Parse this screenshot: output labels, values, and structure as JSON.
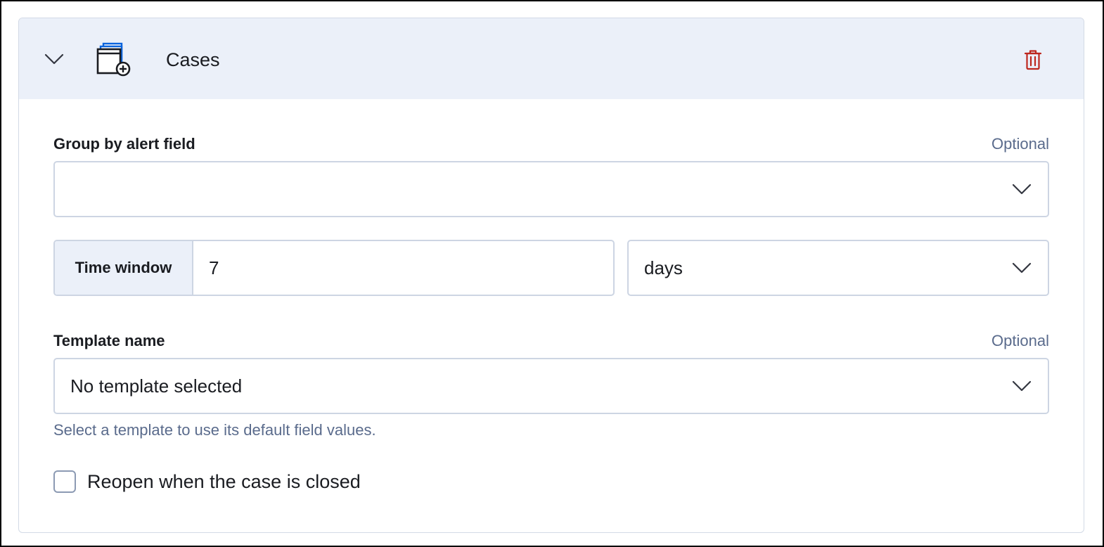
{
  "connector": {
    "title": "Cases",
    "icon": "cases-add-icon",
    "collapse_icon": "chevron-down-icon",
    "delete_icon": "trash-icon"
  },
  "group_by": {
    "label": "Group by alert field",
    "optional": "Optional",
    "value": ""
  },
  "time_window": {
    "label": "Time window",
    "value": "7",
    "unit": "days"
  },
  "template": {
    "label": "Template name",
    "optional": "Optional",
    "value": "No template selected",
    "help": "Select a template to use its default field values."
  },
  "reopen": {
    "label": "Reopen when the case is closed",
    "checked": false
  },
  "colors": {
    "header_bg": "#ebf0f9",
    "border": "#cdd5e3",
    "danger": "#bd271e",
    "icon_blue": "#0b64dd",
    "subdued_text": "#5a6b8c"
  }
}
